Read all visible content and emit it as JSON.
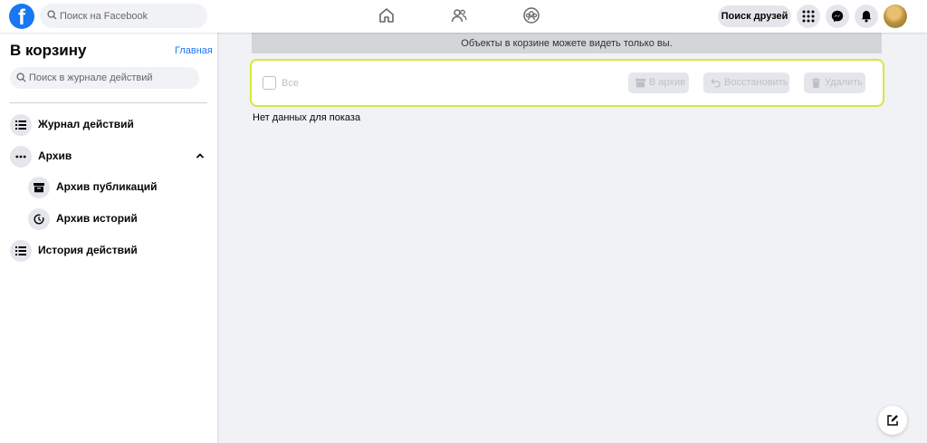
{
  "topbar": {
    "logo_letter": "f",
    "search_placeholder": "Поиск на Facebook",
    "find_friends": "Поиск друзей"
  },
  "sidebar": {
    "title": "В корзину",
    "home_link": "Главная",
    "search_placeholder": "Поиск в журнале действий",
    "items": [
      {
        "label": "Журнал действий",
        "icon": "list-icon"
      },
      {
        "label": "Архив",
        "icon": "more-icon",
        "expanded": true
      },
      {
        "label": "Архив публикаций",
        "icon": "archive-box-icon"
      },
      {
        "label": "Архив историй",
        "icon": "clock-history-icon"
      },
      {
        "label": "История действий",
        "icon": "list-icon"
      }
    ]
  },
  "main": {
    "banner": "Объекты в корзине можете видеть только вы.",
    "select_all": "Все",
    "actions": {
      "archive": "В архив",
      "restore": "Восстановить",
      "delete": "Удалить"
    },
    "empty_message": "Нет данных для показа"
  },
  "colors": {
    "brand": "#1877f2",
    "toolbar_highlight": "#d8e63a"
  }
}
